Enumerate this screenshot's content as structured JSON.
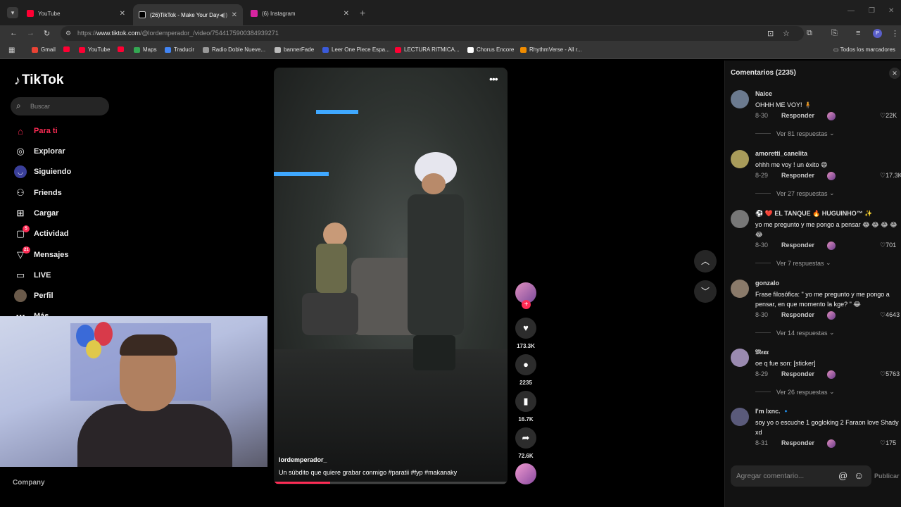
{
  "tabs": [
    {
      "title": "YouTube",
      "fav_color": "#ff0033"
    },
    {
      "title": "(26)TikTok - Make Your Day",
      "fav_color": "#222222"
    },
    {
      "title": "(6) Instagram",
      "fav_color": "#d6249f"
    }
  ],
  "address": {
    "prefix": "https://",
    "host": "www.tiktok.com",
    "path": "/@lordemperador_/video/7544175900384939271"
  },
  "bookmarks": [
    {
      "label": "Gmail",
      "color": "#ea4335"
    },
    {
      "label": "YouTube",
      "color": "#ff0033"
    },
    {
      "label": "Maps",
      "color": "#34a853"
    },
    {
      "label": "Traducir",
      "color": "#4285f4"
    },
    {
      "label": "Radio Doble Nueve...",
      "color": "#999999"
    },
    {
      "label": "bannerFade",
      "color": "#bbbbbb"
    },
    {
      "label": "Leer One Piece Espa...",
      "color": "#3b5bdb"
    },
    {
      "label": "LECTURA RITMICA...",
      "color": "#ff0033"
    },
    {
      "label": "Chorus Encore",
      "color": "#ffffff"
    },
    {
      "label": "RhythmVerse - All r...",
      "color": "#f08c00"
    }
  ],
  "bookmarks_all": "Todos los marcadores",
  "tiktok": {
    "logo": "TikTok",
    "search_placeholder": "Buscar",
    "nav": [
      {
        "label": "Para ti",
        "icon": "home-icon"
      },
      {
        "label": "Explorar",
        "icon": "compass-icon"
      },
      {
        "label": "Siguiendo",
        "icon": "following-icon"
      },
      {
        "label": "Friends",
        "icon": "friends-icon"
      },
      {
        "label": "Cargar",
        "icon": "upload-icon"
      },
      {
        "label": "Actividad",
        "icon": "activity-icon",
        "badge": "5"
      },
      {
        "label": "Mensajes",
        "icon": "messages-icon",
        "badge": "21"
      },
      {
        "label": "LIVE",
        "icon": "live-icon"
      },
      {
        "label": "Perfil",
        "icon": "profile-icon"
      },
      {
        "label": "Más",
        "icon": "more-icon"
      }
    ],
    "company": "Company"
  },
  "video": {
    "author": "lordemperador_",
    "caption": "Un súbdito que quiere grabar conmigo #paratii  #fyp  #makanaky",
    "progress": 0.24,
    "likes": "173.3K",
    "comments": "2235",
    "saves": "16.7K",
    "shares": "72.6K"
  },
  "comments_panel": {
    "title": "Comentarios (2235)",
    "reply_label": "Responder",
    "input_placeholder": "Agregar comentario...",
    "post_label": "Publicar",
    "items": [
      {
        "user": "Naice",
        "text": "OHHH ME VOY! 🧍",
        "date": "8-30",
        "likes": "22K",
        "replies": "Ver 81 respuestas",
        "avatar": "#6b7a8f"
      },
      {
        "user": "amoretti_canelita",
        "text": "ohhh me voy ! un éxito 😄",
        "date": "8-29",
        "likes": "17.3K",
        "replies": "Ver 27 respuestas",
        "avatar": "#a89b5a"
      },
      {
        "user": "⚽ ❤️ EL TANQUE 🔥 HUGUINHO™ ✨",
        "text": "yo me pregunto y me pongo a pensar 😂 😂 😂 😂 😂",
        "date": "8-30",
        "likes": "701",
        "replies": "Ver 7 respuestas",
        "avatar": "#777777"
      },
      {
        "user": "gonzalo",
        "text": "Frase filosófica: \" yo me pregunto y me pongo a pensar, en que momento la kge? \" 😂",
        "date": "8-30",
        "likes": "4643",
        "replies": "Ver 14 respuestas",
        "avatar": "#8a7a6a"
      },
      {
        "user": "𝔐𝔢𝔵𝔵",
        "text": "oe q fue son: [sticker]",
        "date": "8-29",
        "likes": "5763",
        "replies": "Ver 26 respuestas",
        "avatar": "#9a8ab0"
      },
      {
        "user": "I'm lxnc. 🔹",
        "text": "soy yo o escuche 1 gogloking 2 Faraon love Shady xd",
        "date": "8-31",
        "likes": "175",
        "replies": "",
        "avatar": "#5a5a7a"
      }
    ]
  }
}
